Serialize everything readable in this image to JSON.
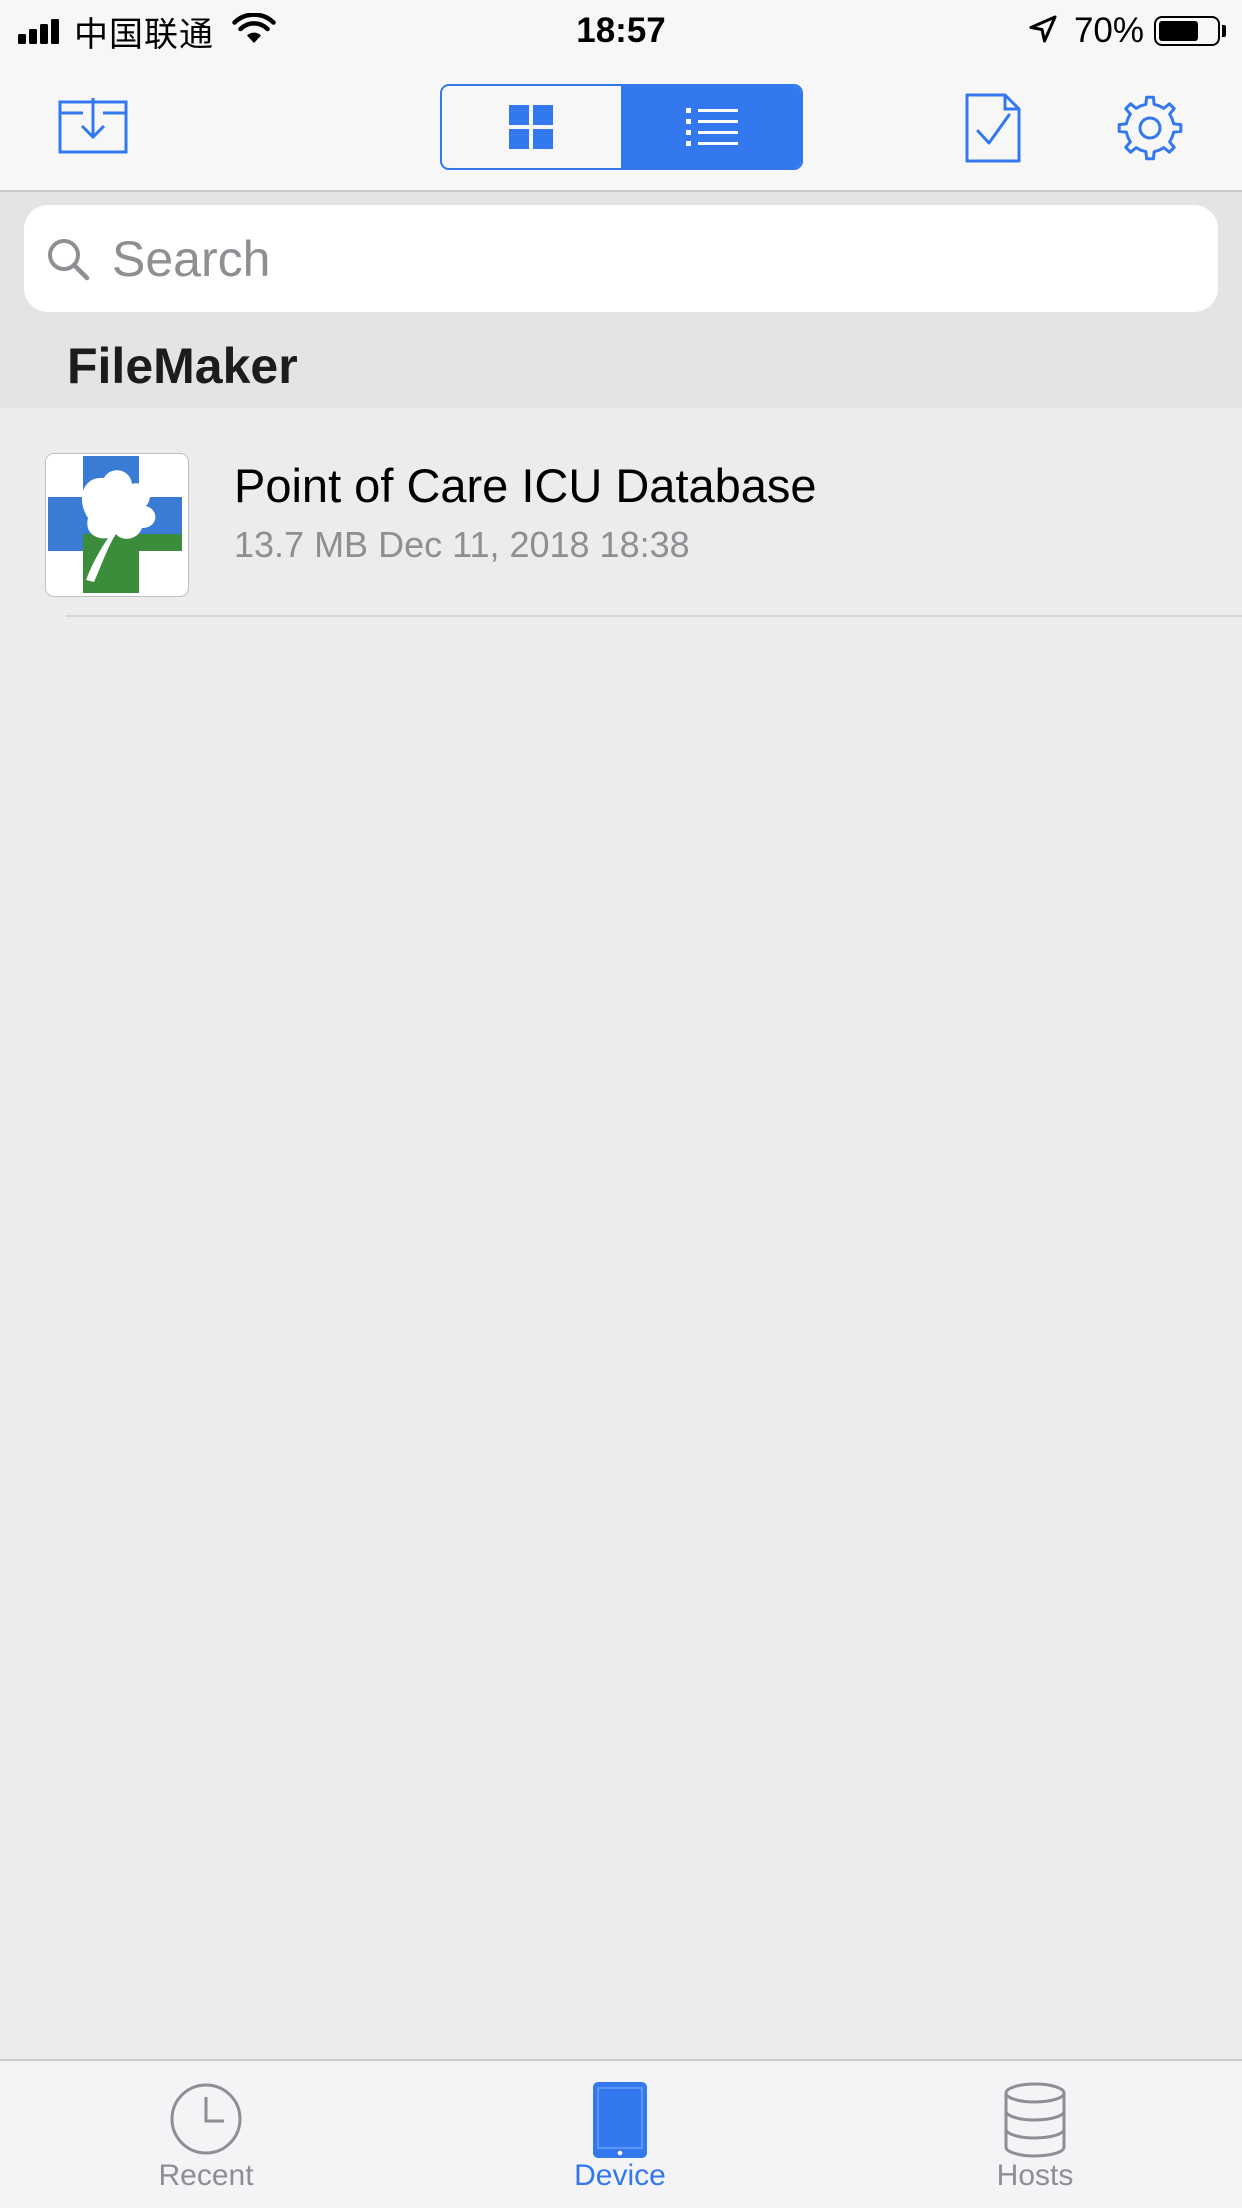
{
  "status_bar": {
    "carrier": "中国联通",
    "time": "18:57",
    "battery_percent": "70%",
    "battery_level": 0.7,
    "signal_bars": 4
  },
  "toolbar": {
    "icons": {
      "import": "tray-arrow-down-icon",
      "grid_view": "grid-icon",
      "list_view": "list-icon",
      "select": "document-checkmark-icon",
      "settings": "gear-icon"
    },
    "active_view": "list"
  },
  "search": {
    "placeholder": "Search",
    "value": ""
  },
  "section": {
    "title": "FileMaker"
  },
  "files": [
    {
      "name": "Point of Care ICU Database",
      "meta": "13.7 MB Dec 11, 2018 18:38"
    }
  ],
  "tab_bar": {
    "tabs": [
      {
        "label": "Recent",
        "icon": "clock-icon",
        "active": false
      },
      {
        "label": "Device",
        "icon": "tablet-icon",
        "active": true
      },
      {
        "label": "Hosts",
        "icon": "database-icon",
        "active": false
      }
    ]
  },
  "colors": {
    "accent": "#3478f0",
    "inactive": "#8e8e93",
    "logo_blue": "#3a7bd5",
    "logo_green": "#3b8c3b"
  }
}
